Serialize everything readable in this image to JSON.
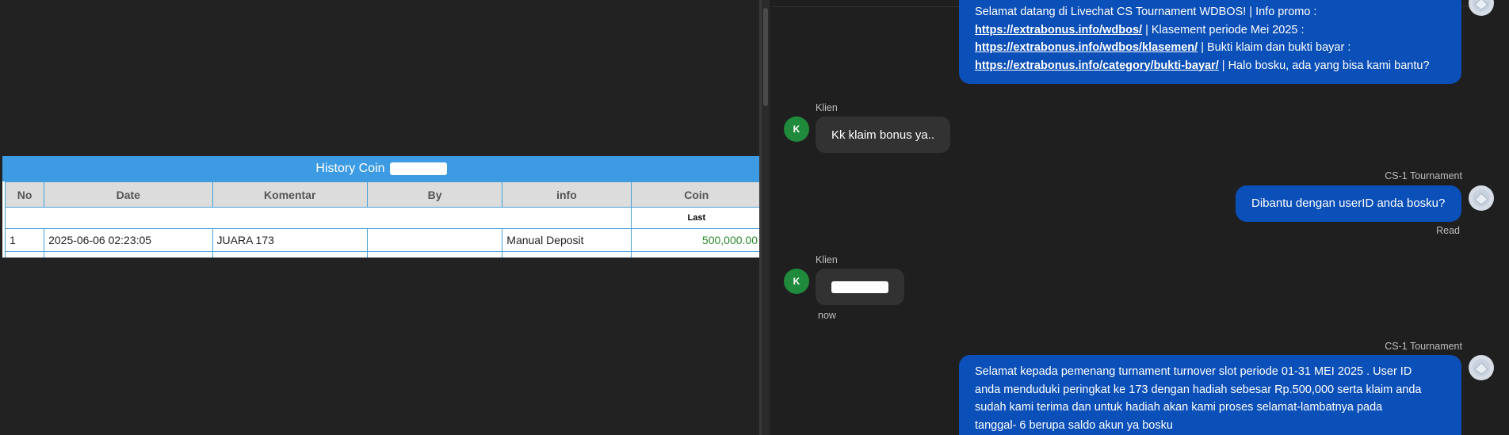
{
  "history": {
    "title": "History Coin",
    "columns": [
      "No",
      "Date",
      "Komentar",
      "By",
      "info",
      "Coin"
    ],
    "sub_header": "Last",
    "rows": [
      {
        "no": "1",
        "date": "2025-06-06 02:23:05",
        "komentar": "JUARA 173",
        "by": "",
        "info": "Manual Deposit",
        "coin": "500,000.00"
      }
    ]
  },
  "chat": {
    "msg1": {
      "p1": "Selamat datang di Livechat CS Tournament WDBOS! | Info promo :",
      "link1": "https://extrabonus.info/wdbos/",
      "p2": " | Klasement periode Mei 2025 :",
      "link2": "https://extrabonus.info/wdbos/klasemen/",
      "p3": " | Bukti klaim dan bukti bayar :",
      "link3": "https://extrabonus.info/category/bukti-bayar/",
      "p4": " | Halo bosku, ada yang bisa kami bantu?"
    },
    "client_label": "Klien",
    "client_avatar": "K",
    "msg2": "Kk klaim bonus ya..",
    "agent_label": "CS-1 Tournament",
    "msg3": "Dibantu dengan userID anda bosku?",
    "msg3_status": "Read",
    "msg4_time": "now",
    "msg5_lines": [
      "Selamat kepada pemenang turnament turnover slot periode 01-31 MEI 2025 . User ID",
      "anda menduduki peringkat ke 173 dengan hadiah sebesar Rp.500,000 serta klaim anda",
      "sudah kami terima dan untuk hadiah akan kami proses selamat-lambatnya pada",
      "tanggal- 6 berupa saldo akun ya bosku"
    ]
  },
  "colors": {
    "agent_bubble": "#0b4fb8",
    "client_bubble": "#323232",
    "table_header": "#3d9be3",
    "coin_value": "#2a8a2a",
    "avatar_client": "#1f8a3c"
  }
}
